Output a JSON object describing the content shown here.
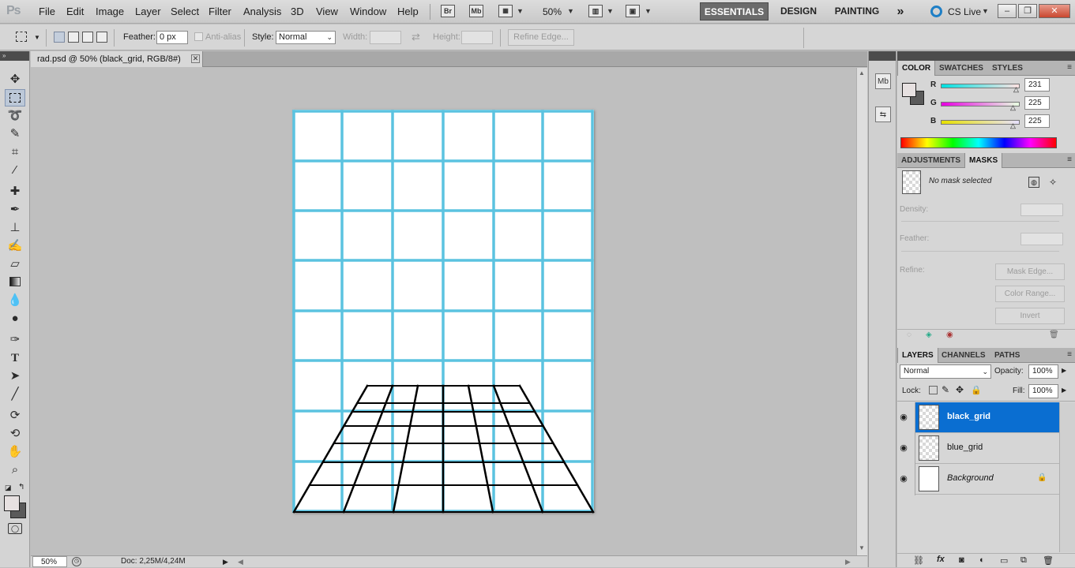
{
  "app": {
    "logo": "Ps",
    "menu": [
      "File",
      "Edit",
      "Image",
      "Layer",
      "Select",
      "Filter",
      "Analysis",
      "3D",
      "View",
      "Window",
      "Help"
    ],
    "appbar_icons": [
      "Br",
      "Mb"
    ],
    "zoom": "50%",
    "workspaces": [
      "ESSENTIALS",
      "DESIGN",
      "PAINTING"
    ],
    "more_workspaces": "»",
    "cs_live": "CS Live",
    "window_controls": [
      "–",
      "❐",
      "✕"
    ]
  },
  "options": {
    "feather_label": "Feather:",
    "feather_value": "0 px",
    "antialias_label": "Anti-alias",
    "style_label": "Style:",
    "style_value": "Normal",
    "width_label": "Width:",
    "height_label": "Height:",
    "refine_edge": "Refine Edge..."
  },
  "document": {
    "tab_title": "rad.psd @ 50% (black_grid, RGB/8#)",
    "close": "✕",
    "status_zoom": "50%",
    "status_doc": "Doc: 2,25M/4,24M",
    "canvas_colors": {
      "blue_grid": "#5bc3e0",
      "black_grid": "#000000",
      "paper": "#ffffff"
    }
  },
  "tools": [
    "move",
    "marquee",
    "lasso",
    "quick-select",
    "crop",
    "eyedropper",
    "spot-heal",
    "brush",
    "clone-stamp",
    "history-brush",
    "eraser",
    "gradient",
    "blur",
    "dodge",
    "pen",
    "type",
    "path-select",
    "line",
    "3d-rotate",
    "3d-orbit",
    "hand",
    "zoom"
  ],
  "color_panel": {
    "tabs": [
      "COLOR",
      "SWATCHES",
      "STYLES"
    ],
    "r_label": "R",
    "r_value": "231",
    "g_label": "G",
    "g_value": "225",
    "b_label": "B",
    "b_value": "225"
  },
  "masks_panel": {
    "tabs": [
      "ADJUSTMENTS",
      "MASKS"
    ],
    "no_mask": "No mask selected",
    "density_label": "Density:",
    "feather_label": "Feather:",
    "refine_label": "Refine:",
    "mask_edge": "Mask Edge...",
    "color_range": "Color Range...",
    "invert": "Invert"
  },
  "layers_panel": {
    "tabs": [
      "LAYERS",
      "CHANNELS",
      "PATHS"
    ],
    "blend_mode": "Normal",
    "opacity_label": "Opacity:",
    "opacity_value": "100%",
    "lock_label": "Lock:",
    "fill_label": "Fill:",
    "fill_value": "100%",
    "layers": [
      {
        "name": "black_grid",
        "selected": true,
        "locked": false
      },
      {
        "name": "blue_grid",
        "selected": false,
        "locked": false
      },
      {
        "name": "Background",
        "selected": false,
        "locked": true
      }
    ],
    "footer_icons": [
      "link",
      "fx",
      "mask",
      "adjustment",
      "group",
      "new-layer",
      "trash"
    ]
  }
}
